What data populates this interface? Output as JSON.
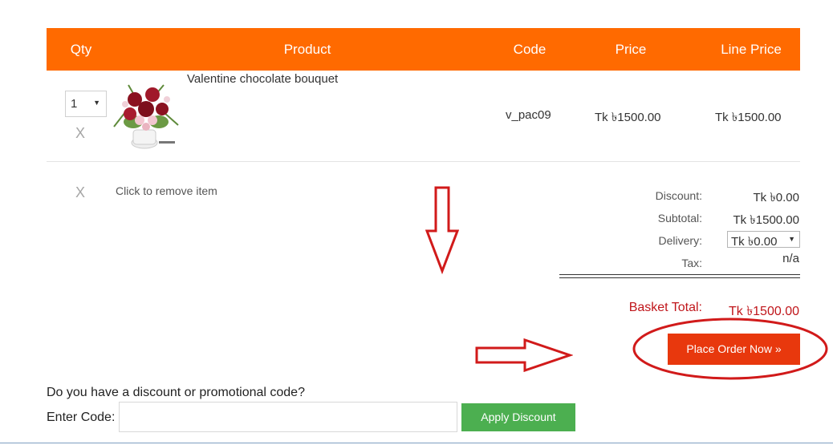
{
  "table": {
    "headers": {
      "qty": "Qty",
      "product": "Product",
      "code": "Code",
      "price": "Price",
      "line_price": "Line Price"
    },
    "items": [
      {
        "qty": "1",
        "remove_label": "X",
        "image_icon": "flower-bouquet-thumbnail",
        "name": "Valentine chocolate bouquet",
        "code": "v_pac09",
        "price": "Tk ৳1500.00",
        "line_price": "Tk ৳1500.00"
      }
    ]
  },
  "remove_hint": {
    "icon_label": "X",
    "text": "Click to remove item"
  },
  "summary": {
    "discount_label": "Discount:",
    "discount_value": "Tk ৳0.00",
    "subtotal_label": "Subtotal:",
    "subtotal_value": "Tk ৳1500.00",
    "delivery_label": "Delivery:",
    "delivery_value": "Tk ৳0.00",
    "tax_label": "Tax:",
    "tax_value": "n/a",
    "total_label": "Basket Total:",
    "total_value": "Tk ৳1500.00",
    "total_color": "#c0161b"
  },
  "place_order_label": "Place Order Now »",
  "promo": {
    "question": "Do you have a discount or promotional code?",
    "code_label": "Enter Code:",
    "code_value": "",
    "apply_label": "Apply Discount"
  },
  "colors": {
    "header_bg": "#ff6a00",
    "place_order_bg": "#e8380d",
    "apply_bg": "#4caf50",
    "annotation_red": "#d11a1a"
  }
}
